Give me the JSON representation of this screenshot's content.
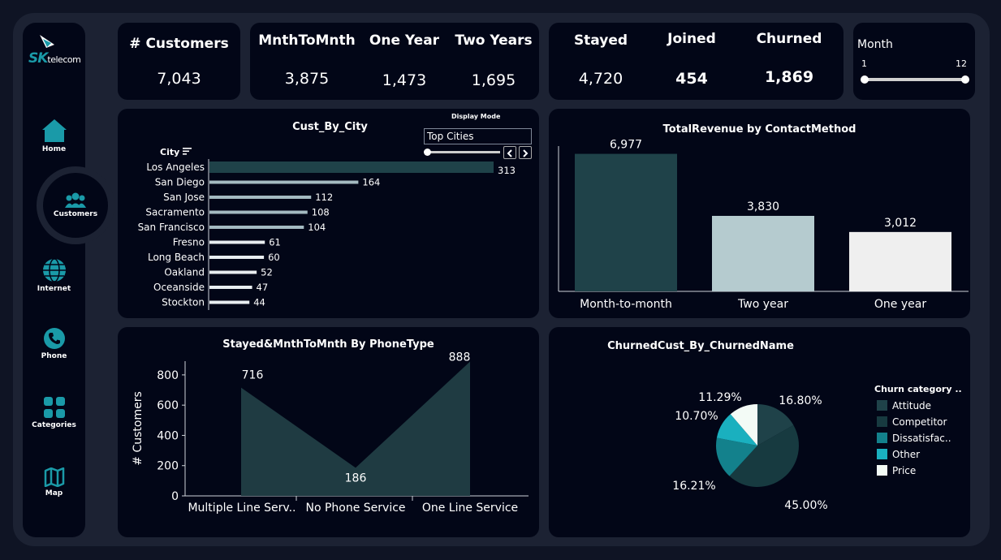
{
  "brand": {
    "logo_main": "SK",
    "logo_sub": "telecom"
  },
  "nav": {
    "items": [
      {
        "label": "Home",
        "icon": "home-icon"
      },
      {
        "label": "Customers",
        "icon": "users-icon"
      },
      {
        "label": "Internet",
        "icon": "globe-icon"
      },
      {
        "label": "Phone",
        "icon": "phone-icon"
      },
      {
        "label": "Categories",
        "icon": "grid-icon"
      },
      {
        "label": "Map",
        "icon": "map-icon"
      }
    ],
    "active": "Customers"
  },
  "kpis": {
    "customers": {
      "label": "# Customers",
      "value": "7,043"
    },
    "m2m": {
      "label": "MnthToMnth",
      "value": "3,875"
    },
    "one_year": {
      "label": "One Year",
      "value": "1,473"
    },
    "two_years": {
      "label": "Two Years",
      "value": "1,695"
    },
    "stayed": {
      "label": "Stayed",
      "value": "4,720"
    },
    "joined": {
      "label": "Joined",
      "value": "454"
    },
    "churned": {
      "label": "Churned",
      "value": "1,869"
    }
  },
  "month_filter": {
    "label": "Month",
    "min": "1",
    "max": "12",
    "range": [
      1,
      12
    ]
  },
  "display_mode": {
    "label": "Display Mode",
    "value": "Top Cities"
  },
  "colors": {
    "accent": "#1a9aa8",
    "dark_teal": "#1f4249",
    "bar_light": "#a4bac1",
    "bg": "#020617",
    "frame": "#1c2233"
  },
  "chart_data": [
    {
      "type": "bar",
      "title": "Cust_By_City",
      "ylabel": "City",
      "orientation": "horizontal",
      "categories": [
        "Los Angeles",
        "San Diego",
        "San Jose",
        "Sacramento",
        "San Francisco",
        "Fresno",
        "Long Beach",
        "Oakland",
        "Oceanside",
        "Stockton"
      ],
      "values": [
        313,
        164,
        112,
        108,
        104,
        61,
        60,
        52,
        47,
        44
      ]
    },
    {
      "type": "bar",
      "title": "TotalRevenue by ContactMethod",
      "categories": [
        "Month-to-month",
        "Two year",
        "One year"
      ],
      "values": [
        6977,
        3830,
        3012
      ],
      "value_labels": [
        "6,977",
        "3,830",
        "3,012"
      ],
      "colors": [
        "#1f4249",
        "#b5cbcf",
        "#efefef"
      ]
    },
    {
      "type": "area",
      "title": "Stayed&MnthToMnth By PhoneType",
      "ylabel": "# Customers",
      "categories": [
        "Multiple Line Serv..",
        "No Phone Service",
        "One Line Service"
      ],
      "values": [
        716,
        186,
        888
      ],
      "yticks": [
        "0",
        "200",
        "400",
        "600",
        "800"
      ],
      "ylim": [
        0,
        880
      ]
    },
    {
      "type": "pie",
      "title": "ChurnedCust_By_ChurnedName",
      "legend_title": "Churn category ..",
      "legend_labels": [
        "Attitude",
        "Competitor",
        "Dissatisfac..",
        "Other",
        "Price"
      ],
      "slices": [
        {
          "name": "Attitude",
          "value": 16.8,
          "label": "16.80%",
          "color": "#1f4249"
        },
        {
          "name": "Competitor",
          "value": 45.0,
          "label": "45.00%",
          "color": "#173a40"
        },
        {
          "name": "Dissatisfaction",
          "value": 16.21,
          "label": "16.21%",
          "color": "#13818c"
        },
        {
          "name": "Other",
          "value": 10.7,
          "label": "10.70%",
          "color": "#1ab0bf"
        },
        {
          "name": "Price",
          "value": 11.29,
          "label": "11.29%",
          "color": "#f3fbf6"
        }
      ]
    }
  ]
}
